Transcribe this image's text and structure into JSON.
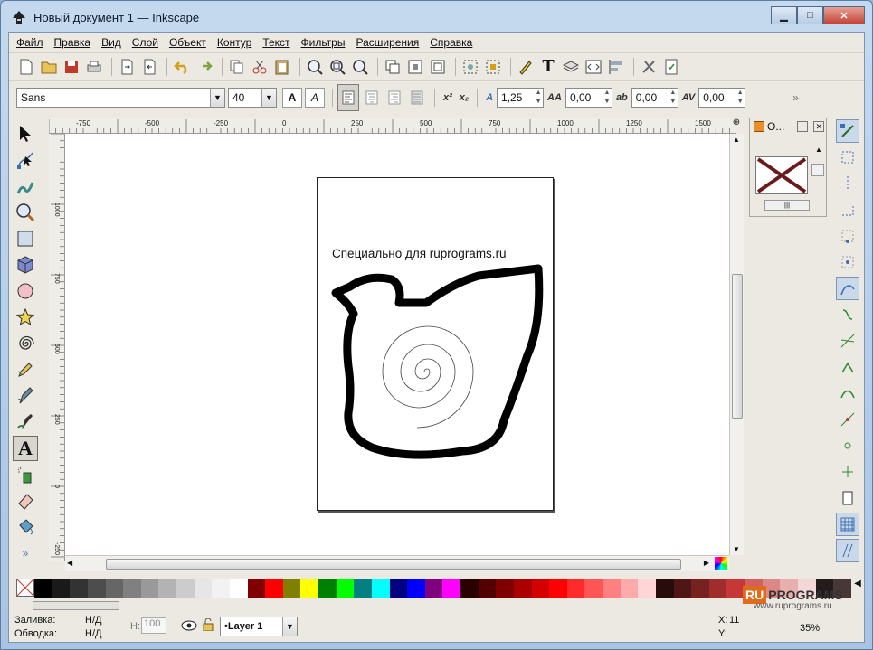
{
  "window": {
    "title": "Новый документ 1 — Inkscape",
    "minimize": "0",
    "maximize": "1",
    "close": "X"
  },
  "menu": [
    "Файл",
    "Правка",
    "Вид",
    "Слой",
    "Объект",
    "Контур",
    "Текст",
    "Фильтры",
    "Расширения",
    "Справка"
  ],
  "text_toolbar": {
    "font_family": "Sans",
    "font_size": "40",
    "line_spacing": "1,25",
    "letter_spacing": "0,00",
    "word_spacing": "0,00",
    "kerning": "0,00"
  },
  "rulers": {
    "horizontal": [
      "-750",
      "-500",
      "-250",
      "0",
      "250",
      "500",
      "750",
      "1000",
      "1250",
      "1500"
    ],
    "vertical": [
      "1000",
      "750",
      "500",
      "250",
      "0",
      "-250"
    ]
  },
  "canvas": {
    "text": "Специально для ruprograms.ru"
  },
  "dock": {
    "title": "O..."
  },
  "palette": [
    "#000000",
    "#1a1a1a",
    "#333333",
    "#4d4d4d",
    "#666666",
    "#808080",
    "#999999",
    "#b3b3b3",
    "#cccccc",
    "#e6e6e6",
    "#f2f2f2",
    "#ffffff",
    "#800000",
    "#ff0000",
    "#808000",
    "#ffff00",
    "#008000",
    "#00ff00",
    "#008080",
    "#00ffff",
    "#000080",
    "#0000ff",
    "#800080",
    "#ff00ff",
    "#2b0000",
    "#550000",
    "#800000",
    "#aa0000",
    "#d40000",
    "#ff0000",
    "#ff2a2a",
    "#ff5555",
    "#ff8080",
    "#ffaaaa",
    "#ffd5d5",
    "#280b0b",
    "#501616",
    "#782121",
    "#a02c2c",
    "#c83737",
    "#d35f5f",
    "#de8787",
    "#e9afaf",
    "#f4d7d7",
    "#241c1c",
    "#483737"
  ],
  "status": {
    "fill_label": "Заливка:",
    "fill_value": "Н/Д",
    "stroke_label": "Обводка:",
    "stroke_value": "Н/Д",
    "h_label": "H:",
    "h_value": "100",
    "layer": "•Layer 1",
    "x_label": "X:",
    "x_value": "11",
    "y_label": "Y:",
    "zoom": "35%"
  },
  "watermark": {
    "ru": "RU",
    "programs": "PROGRAMS",
    "site": "www.ruprograms.ru"
  },
  "colors": {
    "accent": "#e06b18"
  }
}
